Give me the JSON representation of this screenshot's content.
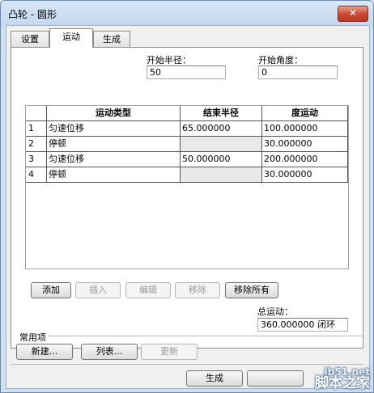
{
  "window": {
    "title": "凸轮 - 圆形",
    "close_glyph": "✕"
  },
  "tabs": [
    {
      "label": "设置",
      "active": false
    },
    {
      "label": "运动",
      "active": true
    },
    {
      "label": "生成",
      "active": false
    }
  ],
  "start_radius": {
    "label": "开始半径：",
    "value": "50"
  },
  "start_angle": {
    "label": "开始角度：",
    "value": "0"
  },
  "table": {
    "columns": [
      "运动类型",
      "结束半径",
      "度运动"
    ],
    "rows": [
      {
        "num": "1",
        "type": "匀速位移",
        "end_radius": "65.000000",
        "degrees": "100.000000"
      },
      {
        "num": "2",
        "type": "停顿",
        "end_radius": "",
        "degrees": "30.000000"
      },
      {
        "num": "3",
        "type": "匀速位移",
        "end_radius": "50.000000",
        "degrees": "200.000000"
      },
      {
        "num": "4",
        "type": "停顿",
        "end_radius": "",
        "degrees": "30.000000"
      }
    ]
  },
  "table_buttons": {
    "add": "添加",
    "insert": "插入",
    "edit": "编辑",
    "remove": "移除",
    "remove_all": "移除所有"
  },
  "total_motion": {
    "label": "总运动：",
    "value": "360.000000 闭环"
  },
  "common": {
    "label": "常用项",
    "new_button": "新建...",
    "list_button": "列表...",
    "update_button": "更新"
  },
  "footer": {
    "generate_button": "生成"
  },
  "watermark": {
    "url": "jb51.net",
    "text": "脚本之家"
  }
}
